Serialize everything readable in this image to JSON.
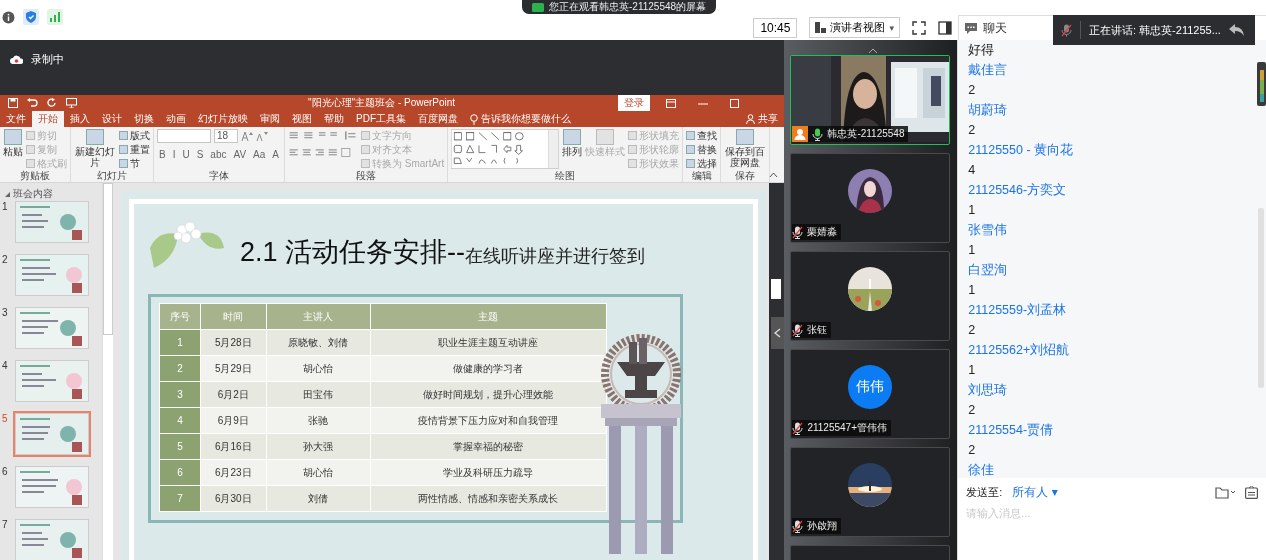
{
  "top_bar": {
    "banner": "您正在观看韩忠英-21125548的屏幕",
    "time": "10:45",
    "view_menu": "演讲者视图",
    "view_caret": "▾"
  },
  "speaking_toast": {
    "text": "正在讲话: 韩忠英-211255..."
  },
  "recording": {
    "label": "录制中"
  },
  "powerpoint": {
    "title": "\"阳光心理\"主题班会  -  PowerPoint",
    "sign_in": "登录",
    "share": "共享",
    "tell_me": "告诉我你想要做什么",
    "tabs": [
      {
        "label": "文件",
        "selected": false
      },
      {
        "label": "开始",
        "selected": true
      },
      {
        "label": "插入",
        "selected": false
      },
      {
        "label": "设计",
        "selected": false
      },
      {
        "label": "切换",
        "selected": false
      },
      {
        "label": "动画",
        "selected": false
      },
      {
        "label": "幻灯片放映",
        "selected": false
      },
      {
        "label": "审阅",
        "selected": false
      },
      {
        "label": "视图",
        "selected": false
      },
      {
        "label": "帮助",
        "selected": false
      },
      {
        "label": "PDF工具集",
        "selected": false
      },
      {
        "label": "百度网盘",
        "selected": false
      }
    ],
    "ribbon": [
      {
        "label": "剪贴板",
        "kind": "buttons",
        "items": [
          {
            "label": "粘贴",
            "kind": "large",
            "disabled": false
          },
          {
            "label": "剪切",
            "kind": "small",
            "disabled": true
          },
          {
            "label": "复制",
            "kind": "small",
            "disabled": true
          },
          {
            "label": "格式刷",
            "kind": "small",
            "disabled": true
          }
        ]
      },
      {
        "label": "幻灯片",
        "kind": "buttons",
        "items": [
          {
            "label": "新建幻灯片",
            "kind": "large",
            "disabled": false
          },
          {
            "label": "版式",
            "kind": "small",
            "disabled": false
          },
          {
            "label": "重置",
            "kind": "small",
            "disabled": false
          },
          {
            "label": "节",
            "kind": "small",
            "disabled": false
          }
        ]
      },
      {
        "label": "字体",
        "kind": "font",
        "font_size": "18",
        "items": [
          {
            "label": "B",
            "kind": "glyph",
            "disabled": false
          },
          {
            "label": "I",
            "kind": "glyph",
            "disabled": false
          },
          {
            "label": "U",
            "kind": "glyph",
            "disabled": false
          },
          {
            "label": "S",
            "kind": "glyph",
            "disabled": false
          },
          {
            "label": "abc",
            "kind": "glyph",
            "disabled": false
          },
          {
            "label": "AV",
            "kind": "glyph",
            "disabled": false
          },
          {
            "label": "Aa",
            "kind": "glyph",
            "disabled": false
          },
          {
            "label": "A",
            "kind": "glyph",
            "disabled": false
          }
        ]
      },
      {
        "label": "段落",
        "kind": "paragraph",
        "items": [
          {
            "label": "文字方向",
            "kind": "small",
            "disabled": true
          },
          {
            "label": "对齐文本",
            "kind": "small",
            "disabled": true
          },
          {
            "label": "转换为 SmartArt",
            "kind": "small",
            "disabled": true
          }
        ]
      },
      {
        "label": "绘图",
        "kind": "drawing",
        "items": [
          {
            "label": "排列",
            "kind": "large",
            "disabled": false
          },
          {
            "label": "快速样式",
            "kind": "large",
            "disabled": true
          },
          {
            "label": "形状填充",
            "kind": "small",
            "disabled": true
          },
          {
            "label": "形状轮廓",
            "kind": "small",
            "disabled": true
          },
          {
            "label": "形状效果",
            "kind": "small",
            "disabled": true
          }
        ]
      },
      {
        "label": "编辑",
        "kind": "buttons",
        "items": [
          {
            "label": "查找",
            "kind": "small",
            "disabled": false
          },
          {
            "label": "替换",
            "kind": "small",
            "disabled": false
          },
          {
            "label": "选择",
            "kind": "small",
            "disabled": false
          }
        ]
      },
      {
        "label": "保存",
        "kind": "buttons",
        "items": [
          {
            "label": "保存到百度网盘",
            "kind": "large",
            "disabled": false
          }
        ]
      }
    ]
  },
  "thumbnails": {
    "section": "班会内容",
    "slides": [
      {
        "number": "1",
        "selected": false
      },
      {
        "number": "2",
        "selected": false
      },
      {
        "number": "3",
        "selected": false
      },
      {
        "number": "4",
        "selected": false
      },
      {
        "number": "5",
        "selected": true
      },
      {
        "number": "6",
        "selected": false
      },
      {
        "number": "7",
        "selected": false
      }
    ]
  },
  "slide": {
    "title": "2.1  活动任务安排--",
    "subtitle": "在线听讲座并进行签到",
    "table": {
      "columns": [
        "序号",
        "时间",
        "主讲人",
        "主题"
      ],
      "rows": [
        [
          "1",
          "5月28日",
          "原晓敏、刘倩",
          "职业生涯主题互动讲座"
        ],
        [
          "2",
          "5月29日",
          "胡心怡",
          "做健康的学习者"
        ],
        [
          "3",
          "6月2日",
          "田宝伟",
          "做好时间规划，提升心理效能"
        ],
        [
          "4",
          "6月9日",
          "张驰",
          "疫情背景下压力应对和自我管理"
        ],
        [
          "5",
          "6月16日",
          "孙大强",
          "掌握幸福的秘密"
        ],
        [
          "6",
          "6月23日",
          "胡心怡",
          "学业及科研压力疏导"
        ],
        [
          "7",
          "6月30日",
          "刘倩",
          "两性情感、情感和亲密关系成长"
        ]
      ]
    }
  },
  "participants": [
    {
      "name": "韩忠英-21125548",
      "avatar": {
        "kind": "video"
      },
      "muted": false,
      "host": true,
      "speaking": true
    },
    {
      "name": "栗婧淼",
      "muted": true,
      "host": false,
      "speaking": false
    },
    {
      "name": "张钰",
      "muted": true,
      "host": false,
      "speaking": false
    },
    {
      "name": "21125547+管伟伟",
      "avatar": {
        "kind": "initials",
        "text": "伟伟"
      },
      "muted": true,
      "host": false,
      "speaking": false
    },
    {
      "name": "孙啟翔",
      "muted": true,
      "host": false,
      "speaking": false
    }
  ],
  "chat": {
    "title": "聊天",
    "send_to_label": "发送至:",
    "send_to_value": "所有人",
    "send_to_caret": "▾",
    "placeholder": "请输入消息...",
    "lines": [
      {
        "kind": "text",
        "text": "好得"
      },
      {
        "kind": "sender",
        "text": "戴佳言"
      },
      {
        "kind": "text",
        "text": "2"
      },
      {
        "kind": "sender",
        "text": "胡蔚琦"
      },
      {
        "kind": "text",
        "text": "2"
      },
      {
        "kind": "sender",
        "text": "21125550 - 黄向花"
      },
      {
        "kind": "text",
        "text": "4"
      },
      {
        "kind": "sender",
        "text": "21125546-方奕文"
      },
      {
        "kind": "text",
        "text": "1"
      },
      {
        "kind": "sender",
        "text": "张雪伟"
      },
      {
        "kind": "text",
        "text": "1"
      },
      {
        "kind": "sender",
        "text": "白翌洵"
      },
      {
        "kind": "text",
        "text": "1"
      },
      {
        "kind": "sender",
        "text": "21125559-刘孟林"
      },
      {
        "kind": "text",
        "text": "2"
      },
      {
        "kind": "sender",
        "text": "21125562+刘炤航"
      },
      {
        "kind": "text",
        "text": "1"
      },
      {
        "kind": "sender",
        "text": "刘思琦"
      },
      {
        "kind": "text",
        "text": "2"
      },
      {
        "kind": "sender",
        "text": "21125554-贾倩"
      },
      {
        "kind": "text",
        "text": "2"
      },
      {
        "kind": "sender",
        "text": "徐佳"
      }
    ]
  }
}
